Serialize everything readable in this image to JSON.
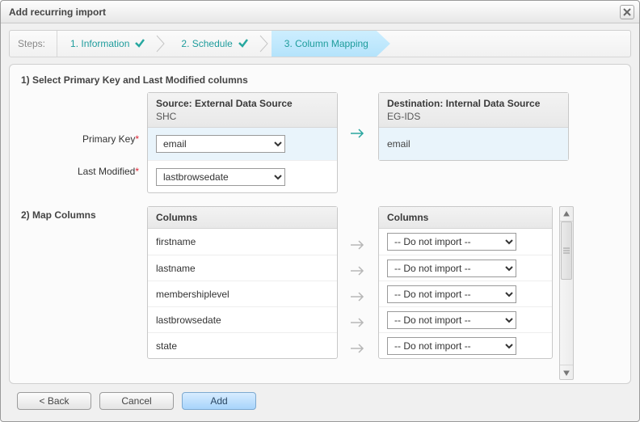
{
  "dialog": {
    "title": "Add recurring import"
  },
  "wizard": {
    "label": "Steps:",
    "steps": [
      {
        "label": "1. Information",
        "done": true,
        "current": false
      },
      {
        "label": "2. Schedule",
        "done": true,
        "current": false
      },
      {
        "label": "3. Column Mapping",
        "done": false,
        "current": true
      }
    ]
  },
  "section1": {
    "title": "1) Select Primary Key and Last Modified columns",
    "labels": {
      "primaryKey": "Primary Key",
      "lastModified": "Last Modified"
    },
    "source": {
      "heading": "Source: External Data Source",
      "sub": "SHC",
      "primaryKey": "email",
      "lastModified": "lastbrowsedate"
    },
    "destination": {
      "heading": "Destination: Internal Data Source",
      "sub": "EG-IDS",
      "primaryKey": "email"
    }
  },
  "section2": {
    "title": "2) Map Columns",
    "sourceHeading": "Columns",
    "destHeading": "Columns",
    "doNotImport": "-- Do not import --",
    "rows": [
      {
        "src": "firstname",
        "dest": "-- Do not import --"
      },
      {
        "src": "lastname",
        "dest": "-- Do not import --"
      },
      {
        "src": "membershiplevel",
        "dest": "-- Do not import --"
      },
      {
        "src": "lastbrowsedate",
        "dest": "-- Do not import --"
      },
      {
        "src": "state",
        "dest": "-- Do not import --"
      }
    ]
  },
  "buttons": {
    "back": "< Back",
    "cancel": "Cancel",
    "add": "Add"
  }
}
